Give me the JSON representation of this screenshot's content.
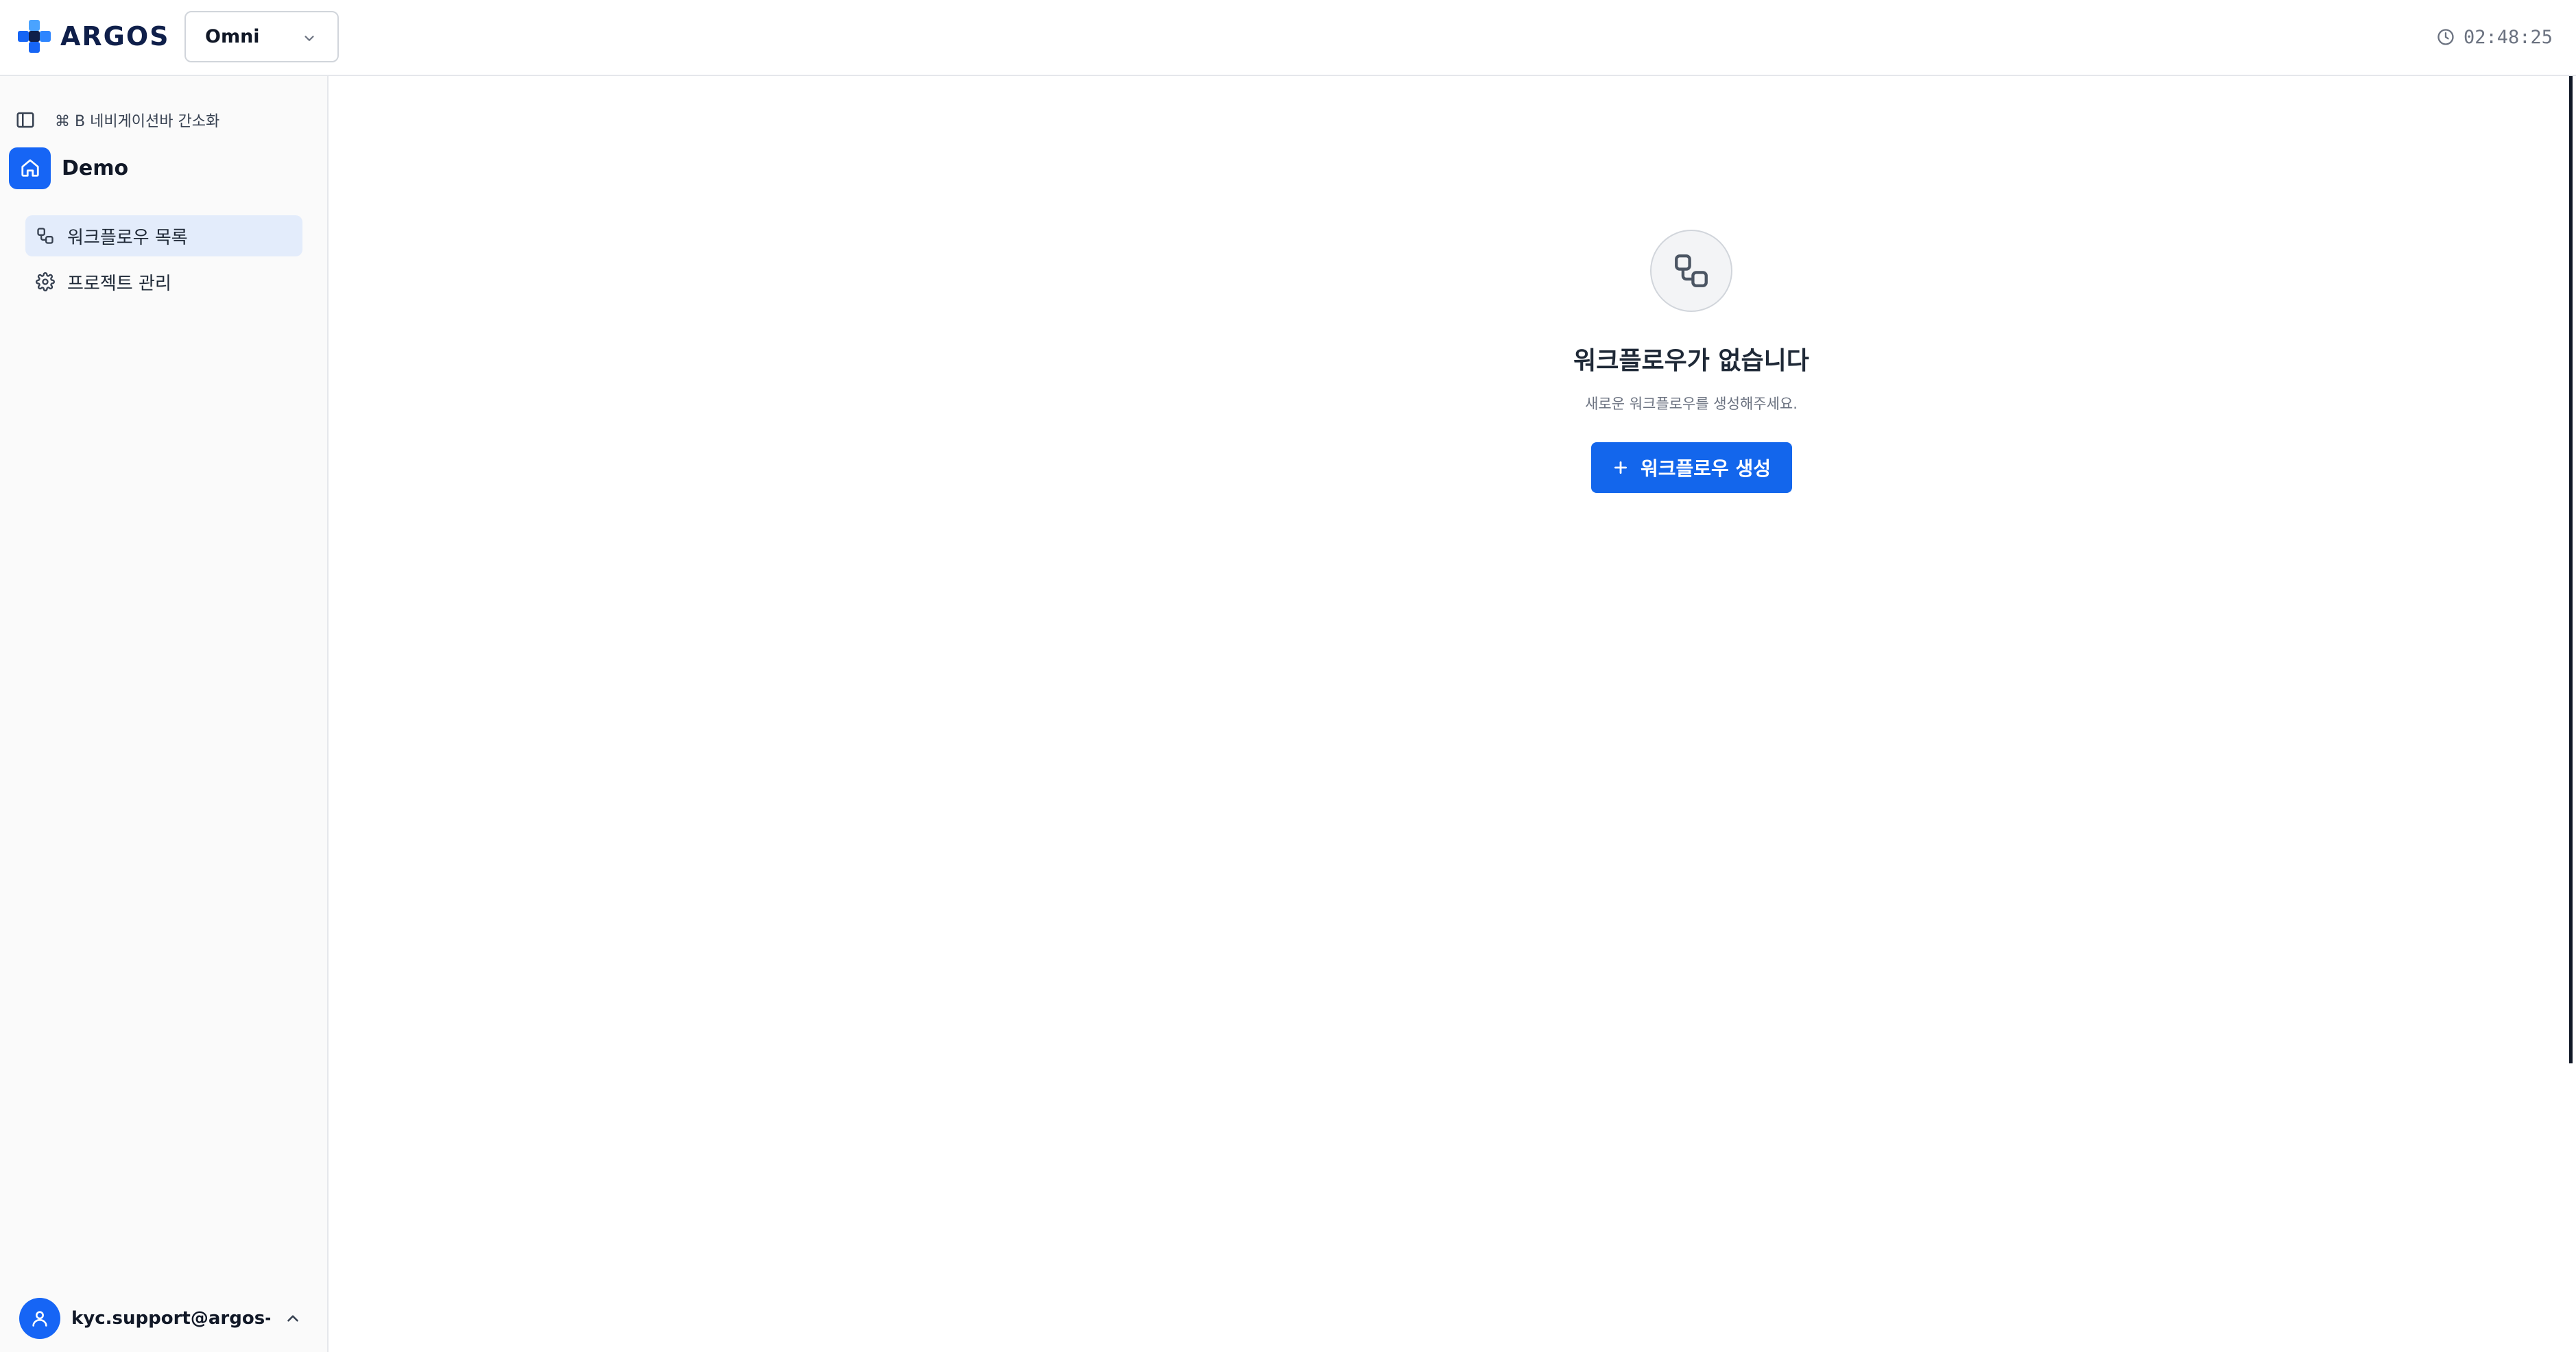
{
  "header": {
    "logo_text": "ARGOS",
    "org_select_value": "Omni",
    "time": "02:48:25"
  },
  "sidebar": {
    "collapse_hint": "⌘ B 네비게이션바 간소화",
    "project_name": "Demo",
    "items": [
      {
        "label": "워크플로우 목록",
        "icon": "workflow-icon",
        "active": true
      },
      {
        "label": "프로젝트 관리",
        "icon": "gear-icon",
        "active": false
      }
    ],
    "user_email": "kyc.support@argos-s..."
  },
  "main": {
    "empty_title": "워크플로우가 없습니다",
    "empty_subtitle": "새로운 워크플로우를 생성해주세요.",
    "create_button_label": "워크플로우 생성"
  },
  "colors": {
    "accent": "#1366ec",
    "active_nav_bg": "#e3ecfb",
    "logo_dark": "#0f1f4a"
  }
}
